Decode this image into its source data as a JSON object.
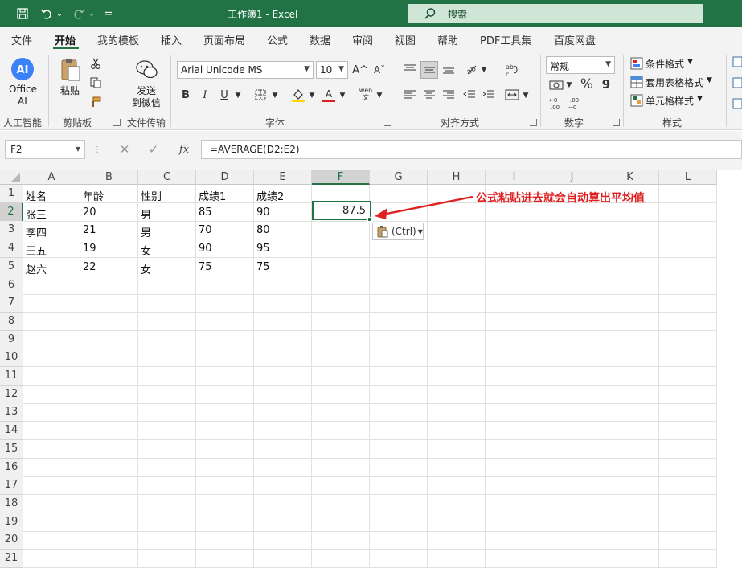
{
  "window": {
    "title": "工作簿1  -  Excel",
    "search_label": "搜索"
  },
  "quickaccess": {
    "dropdown": "⌄",
    "customize": "="
  },
  "menu": [
    "文件",
    "开始",
    "我的模板",
    "插入",
    "页面布局",
    "公式",
    "数据",
    "审阅",
    "视图",
    "帮助",
    "PDF工具集",
    "百度网盘"
  ],
  "ribbon": {
    "ai": {
      "line1": "Office",
      "line2": "AI",
      "group": "人工智能"
    },
    "clipboard": {
      "paste": "粘贴",
      "group": "剪贴板"
    },
    "wechat": {
      "line1": "发送",
      "line2": "到微信",
      "group": "文件传输"
    },
    "font": {
      "name": "Arial Unicode MS",
      "size": "10",
      "group": "字体",
      "bold": "B",
      "italic": "I",
      "underline": "U",
      "grow": "A^",
      "shrink": "Aˇ",
      "phonetic_top": "wén",
      "phonetic_bottom": "文"
    },
    "alignment": {
      "group": "对齐方式"
    },
    "number": {
      "format": "常规",
      "percent": "%",
      "comma": "9",
      "group": "数字"
    },
    "styles": {
      "conditional": "条件格式",
      "table": "套用表格格式",
      "cell": "单元格样式",
      "group": "样式"
    }
  },
  "formula_bar": {
    "namebox": "F2",
    "fx": "fx",
    "formula": "=AVERAGE(D2:E2)"
  },
  "columns": [
    "A",
    "B",
    "C",
    "D",
    "E",
    "F",
    "G",
    "H",
    "I",
    "J",
    "K",
    "L"
  ],
  "rows": [
    "1",
    "2",
    "3",
    "4",
    "5",
    "6",
    "7",
    "8",
    "9",
    "10",
    "11",
    "12",
    "13",
    "14",
    "15",
    "16",
    "17",
    "18",
    "19",
    "20",
    "21"
  ],
  "table": [
    [
      "姓名",
      "年龄",
      "性别",
      "成绩1",
      "成绩2"
    ],
    [
      "张三",
      "20",
      "男",
      "85",
      "90"
    ],
    [
      "李四",
      "21",
      "男",
      "70",
      "80"
    ],
    [
      "王五",
      "19",
      "女",
      "90",
      "95"
    ],
    [
      "赵六",
      "22",
      "女",
      "75",
      "75"
    ]
  ],
  "selected": {
    "value": "87.5"
  },
  "paste_options": "(Ctrl)",
  "annotation": "公式粘贴进去就会自动算出平均值",
  "colors": {
    "accent": "#217346",
    "annotation": "#e02020"
  }
}
